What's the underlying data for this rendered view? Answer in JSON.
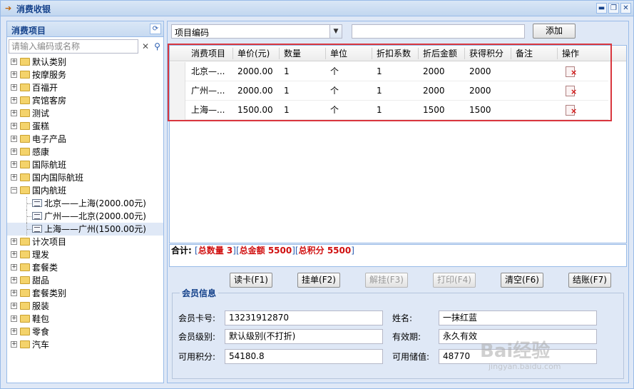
{
  "window": {
    "title": "消费收银",
    "buttons": [
      "▬",
      "❐",
      "✕"
    ]
  },
  "left_panel": {
    "title": "消费项目",
    "search_placeholder": "请输入编码或名称",
    "tree": [
      {
        "label": "默认类别",
        "expanded": false
      },
      {
        "label": "按摩服务",
        "expanded": false
      },
      {
        "label": "百福开",
        "expanded": false
      },
      {
        "label": "宾馆客房",
        "expanded": false
      },
      {
        "label": "测试",
        "expanded": false
      },
      {
        "label": "蛋糕",
        "expanded": false
      },
      {
        "label": "电子产品",
        "expanded": false
      },
      {
        "label": "感康",
        "expanded": false
      },
      {
        "label": "国际航班",
        "expanded": false
      },
      {
        "label": "国内国际航班",
        "expanded": false
      },
      {
        "label": "国内航班",
        "expanded": true,
        "children": [
          "北京——上海(2000.00元)",
          "广州——北京(2000.00元)",
          "上海——广州(1500.00元)"
        ]
      },
      {
        "label": "计次项目",
        "expanded": false
      },
      {
        "label": "理发",
        "expanded": false
      },
      {
        "label": "套餐类",
        "expanded": false
      },
      {
        "label": "甜品",
        "expanded": false
      },
      {
        "label": "套餐类别",
        "expanded": false
      },
      {
        "label": "服装",
        "expanded": false
      },
      {
        "label": "鞋包",
        "expanded": false
      },
      {
        "label": "零食",
        "expanded": false
      },
      {
        "label": "汽车",
        "expanded": false
      }
    ]
  },
  "toolbar": {
    "combo_value": "项目编码",
    "code_value": "",
    "add_label": "添加"
  },
  "grid": {
    "columns": [
      "消费项目",
      "单价(元)",
      "数量",
      "单位",
      "折扣系数",
      "折后金额",
      "获得积分",
      "备注",
      "操作"
    ],
    "rows": [
      [
        "北京—...",
        "2000.00",
        "1",
        "个",
        "1",
        "2000",
        "2000",
        ""
      ],
      [
        "广州—...",
        "2000.00",
        "1",
        "个",
        "1",
        "2000",
        "2000",
        ""
      ],
      [
        "上海—...",
        "1500.00",
        "1",
        "个",
        "1",
        "1500",
        "1500",
        ""
      ]
    ]
  },
  "summary": {
    "label": "合计:",
    "qty_label": "总数量",
    "qty": "3",
    "amount_label": "总金额",
    "amount": "5500",
    "points_label": "总积分",
    "points": "5500"
  },
  "actions": {
    "read_card": "读卡(F1)",
    "hold": "挂单(F2)",
    "unhold": "解挂(F3)",
    "print": "打印(F4)",
    "clear": "清空(F6)",
    "checkout": "结账(F7)"
  },
  "member": {
    "legend": "会员信息",
    "card_label": "会员卡号:",
    "card_value": "13231912870",
    "name_label": "姓名:",
    "name_value": "一抹红蓝",
    "level_label": "会员级别:",
    "level_value": "默认级别(不打折)",
    "validity_label": "有效期:",
    "validity_value": "永久有效",
    "points_label": "可用积分:",
    "points_value": "54180.8",
    "balance_label": "可用储值:",
    "balance_value": "48770"
  },
  "watermark": {
    "text": "Bai经验",
    "sub": "jingyan.baidu.com"
  },
  "colors": {
    "accent": "#15428b",
    "highlight_border": "#d9363e",
    "summary_red": "#d01010"
  }
}
